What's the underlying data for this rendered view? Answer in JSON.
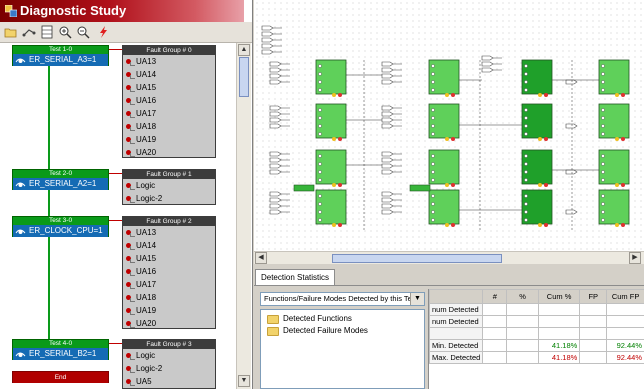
{
  "app": {
    "title": "Diagnostic Study"
  },
  "toolbar": {
    "icons": [
      "folder-open-icon",
      "connect-icon",
      "grid-icon",
      "zoom-in-icon",
      "zoom-out-icon",
      "lightning-icon"
    ]
  },
  "tests": [
    {
      "header": "Test 1-0",
      "name": "ER_SERIAL_A3=1"
    },
    {
      "header": "Test 2-0",
      "name": "ER_SERIAL_A2=1"
    },
    {
      "header": "Test 3-0",
      "name": "ER_CLOCK_CPU=1"
    },
    {
      "header": "Test 4-0",
      "name": "ER_SERIAL_B2=1"
    },
    {
      "header": "End"
    }
  ],
  "fault_groups": [
    {
      "header": "Fault Group # 0",
      "items": [
        "UA13",
        "UA14",
        "UA15",
        "UA16",
        "UA17",
        "UA18",
        "UA19",
        "UA20"
      ]
    },
    {
      "header": "Fault Group # 1",
      "items": [
        "Logic",
        "Logic-2"
      ]
    },
    {
      "header": "Fault Group # 2",
      "items": [
        "UA13",
        "UA14",
        "UA15",
        "UA16",
        "UA17",
        "UA18",
        "UA19",
        "UA20"
      ]
    },
    {
      "header": "Fault Group # 3",
      "items": [
        "Logic",
        "Logic-2",
        "UA5"
      ]
    }
  ],
  "bottom": {
    "tab_label": "Detection Statistics",
    "combo_value": "Functions/Failure Modes Detected by this Test",
    "tree_items": [
      "Detected Functions",
      "Detected Failure Modes"
    ],
    "table": {
      "columns": [
        "",
        "#",
        "%",
        "Cum %",
        "FP",
        "Cum FP"
      ],
      "rows": [
        [
          "num Detected",
          "",
          "",
          "",
          "",
          ""
        ],
        [
          "num Detected",
          "",
          "",
          "",
          "",
          ""
        ],
        [
          "",
          "",
          "",
          "",
          "",
          ""
        ],
        [
          "Min. Detected",
          "",
          "",
          "41.18%",
          "",
          "92.44%"
        ],
        [
          "Max. Detected",
          "",
          "",
          "41.18%",
          "",
          "92.44%"
        ]
      ]
    }
  }
}
